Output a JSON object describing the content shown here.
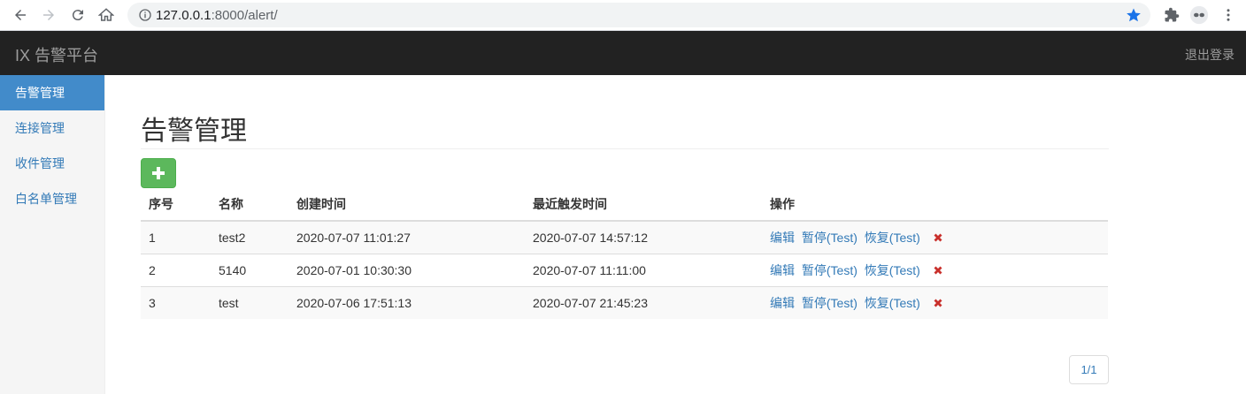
{
  "browser": {
    "url_host": "127.0.0.1",
    "url_rest": ":8000/alert/"
  },
  "navbar": {
    "brand": "IX 告警平台",
    "logout": "退出登录"
  },
  "sidebar": {
    "items": [
      {
        "label": "告警管理",
        "active": true
      },
      {
        "label": "连接管理",
        "active": false
      },
      {
        "label": "收件管理",
        "active": false
      },
      {
        "label": "白名单管理",
        "active": false
      }
    ]
  },
  "main": {
    "title": "告警管理",
    "table": {
      "headers": [
        "序号",
        "名称",
        "创建时间",
        "最近触发时间",
        "操作"
      ],
      "rows": [
        {
          "id": "1",
          "name": "test2",
          "created": "2020-07-07 11:01:27",
          "last_triggered": "2020-07-07 14:57:12"
        },
        {
          "id": "2",
          "name": "5140",
          "created": "2020-07-01 10:30:30",
          "last_triggered": "2020-07-07 11:11:00"
        },
        {
          "id": "3",
          "name": "test",
          "created": "2020-07-06 17:51:13",
          "last_triggered": "2020-07-07 21:45:23"
        }
      ],
      "actions": {
        "edit": "编辑",
        "pause": "暂停(Test)",
        "resume": "恢复(Test)"
      }
    },
    "pagination": "1/1"
  },
  "colors": {
    "navbar_bg": "#222222",
    "sidebar_active": "#428bca",
    "link": "#337ab7",
    "add_button": "#5cb85c",
    "delete": "#d9534f"
  }
}
